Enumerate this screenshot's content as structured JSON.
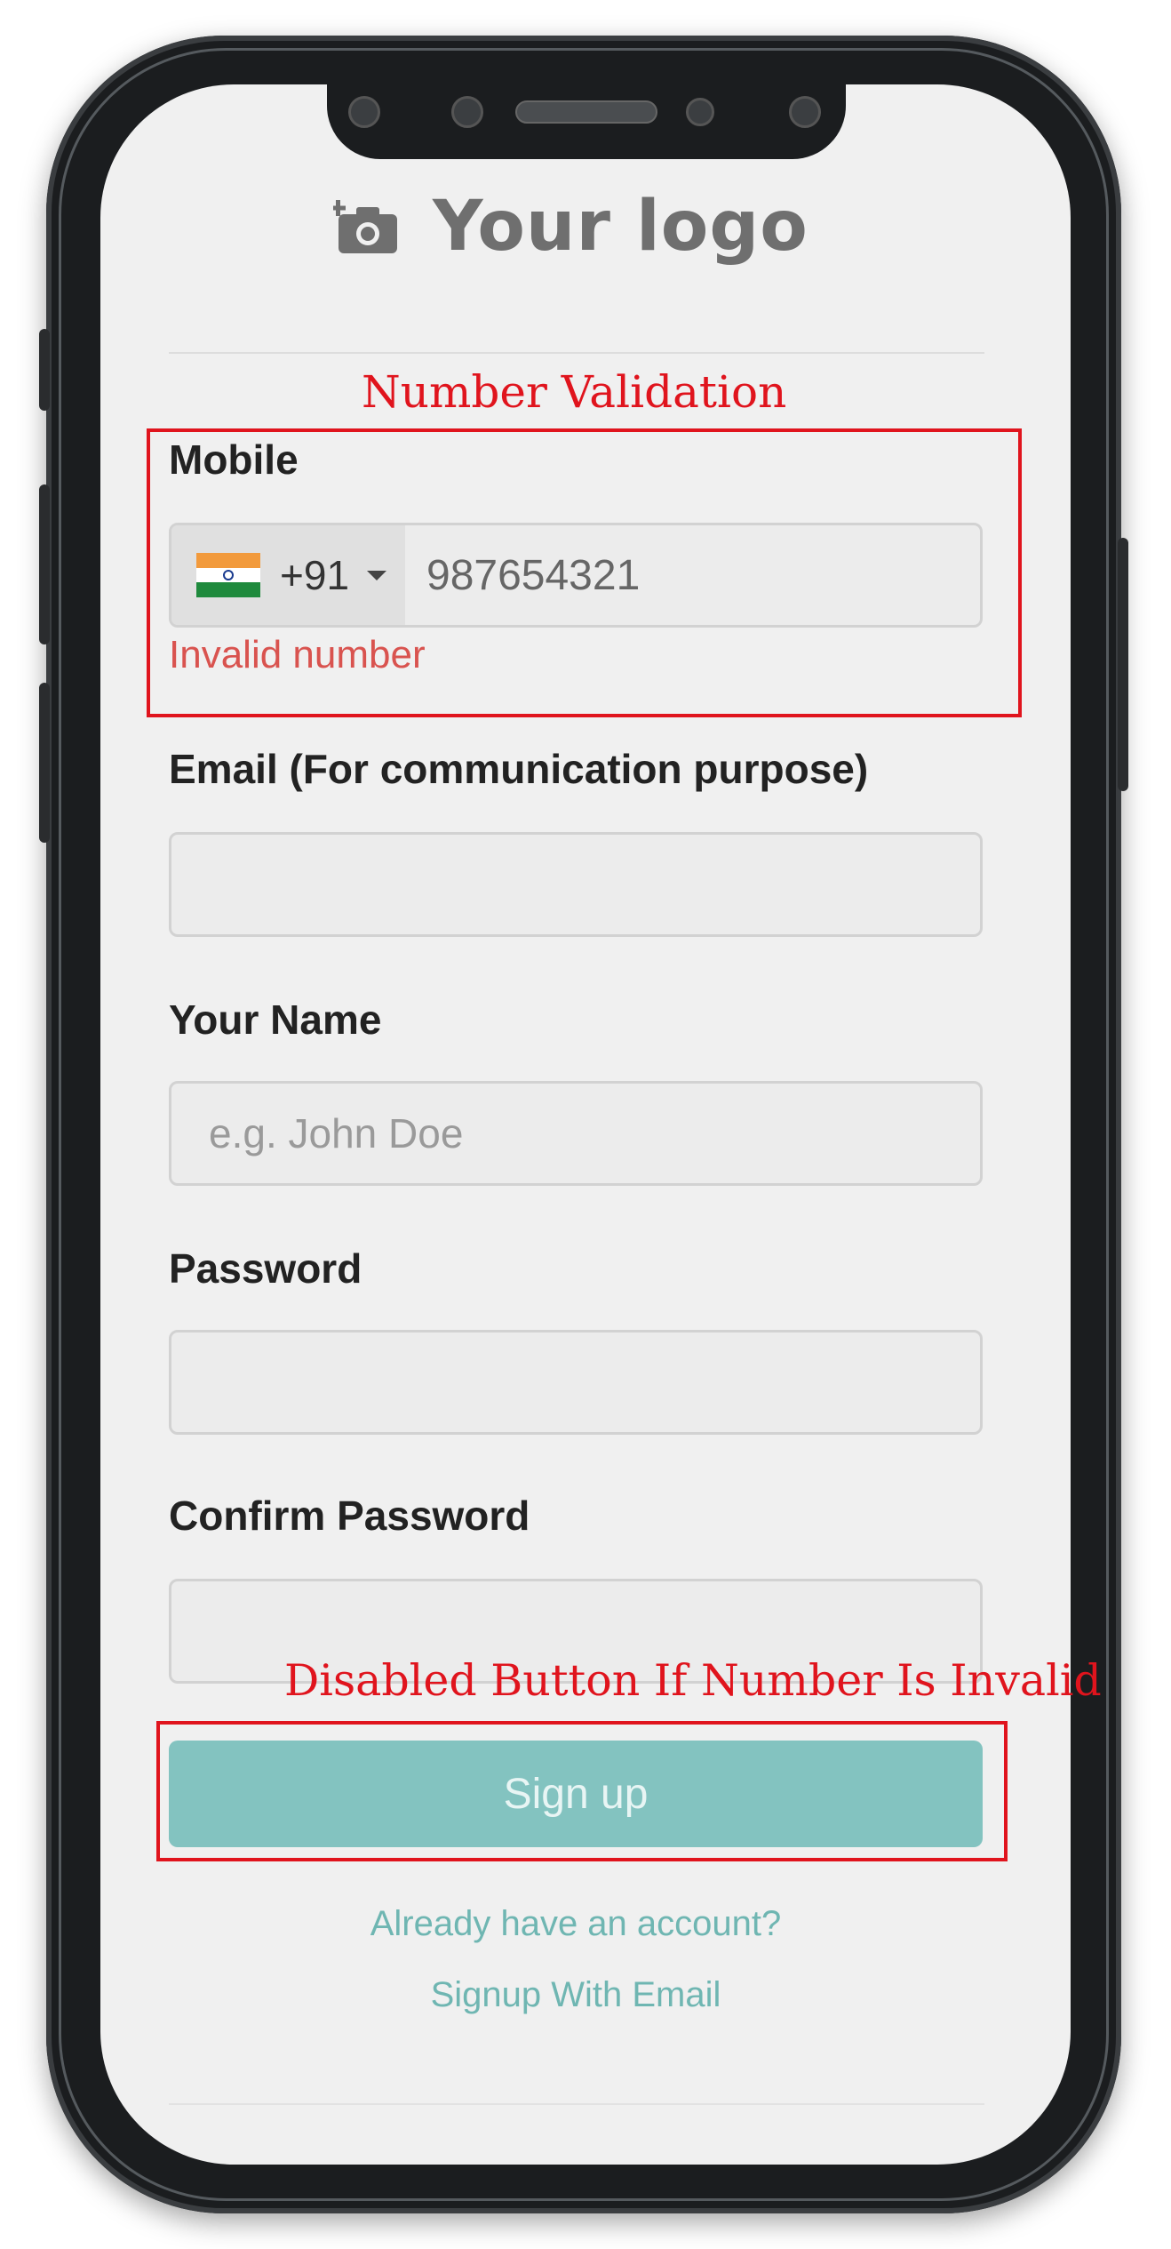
{
  "logo": {
    "text": "Your logo",
    "icon": "camera-add-icon"
  },
  "annotations": {
    "number_validation": "Number Validation",
    "disabled_button": "Disabled Button If Number Is Invalid",
    "color": "#e0141d"
  },
  "form": {
    "mobile": {
      "label": "Mobile",
      "country_flag": "india-flag-icon",
      "dial_code": "+91",
      "value": "987654321",
      "error": "Invalid number"
    },
    "email": {
      "label": "Email (For communication purpose)",
      "value": "",
      "placeholder": ""
    },
    "name": {
      "label": "Your Name",
      "value": "",
      "placeholder": "e.g. John Doe"
    },
    "password": {
      "label": "Password",
      "value": ""
    },
    "confirm_password": {
      "label": "Confirm Password",
      "value": ""
    },
    "submit": {
      "label": "Sign up",
      "disabled": true,
      "color": "#83c3c0"
    }
  },
  "links": {
    "login": "Already have an account?",
    "signup_email": "Signup With Email"
  }
}
